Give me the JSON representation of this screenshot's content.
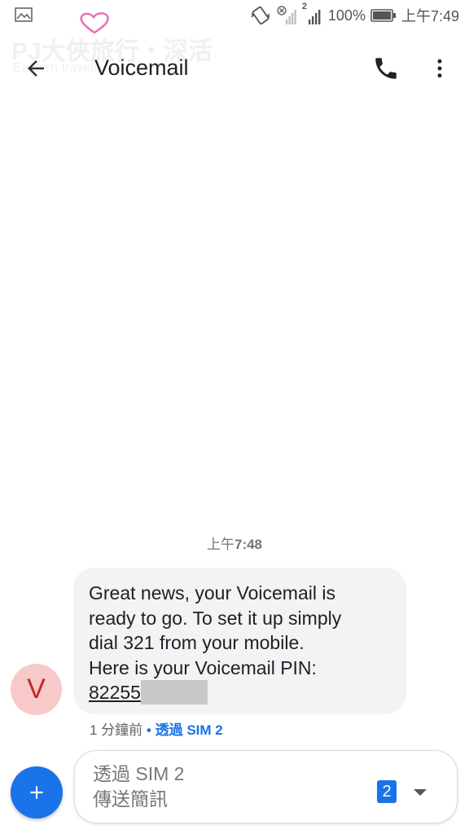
{
  "status_bar": {
    "battery_percent": "100%",
    "time": "上午7:49",
    "sim_number": "2"
  },
  "watermark": {
    "title": "PJ大俠旅行・深活",
    "subtitle": "Eastern traveller 2"
  },
  "app_bar": {
    "title": "Voicemail",
    "back_icon": "arrow-back-icon",
    "call_icon": "phone-icon",
    "more_icon": "more-vert-icon"
  },
  "conversation": {
    "timestamp_prefix": "上午",
    "timestamp_time": "7:48",
    "message": {
      "avatar_letter": "V",
      "line1": "Great news, your Voicemail is",
      "line2": "ready to go. To set it up simply",
      "line3": "dial 321 from your mobile.",
      "line4": "Here is your Voicemail PIN:",
      "pin_visible": "82255",
      "meta_time": "1 分鐘前",
      "meta_separator": " • ",
      "meta_sim": "透過 SIM 2"
    }
  },
  "compose": {
    "line1": "透過 SIM 2",
    "line2": "傳送簡訊",
    "sim_badge": "2"
  },
  "colors": {
    "accent": "#1a73e8",
    "bubble": "#f1f3f4",
    "avatar_bg": "#f7c9c9",
    "avatar_fg": "#c62828"
  }
}
